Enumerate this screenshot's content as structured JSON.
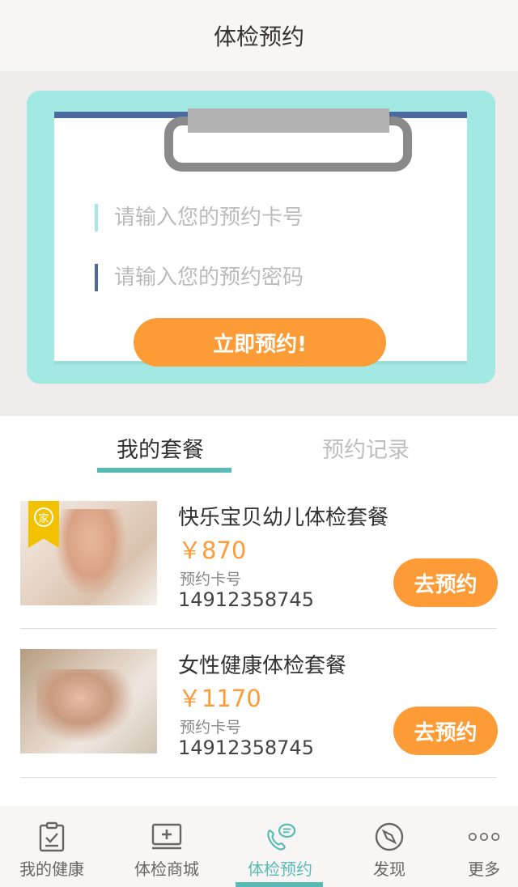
{
  "header": {
    "title": "体检预约"
  },
  "booking": {
    "card_placeholder": "请输入您的预约卡号",
    "password_placeholder": "请输入您的预约密码",
    "submit_label": "立即预约!"
  },
  "tabs": [
    {
      "label": "我的套餐",
      "active": true
    },
    {
      "label": "预约记录",
      "active": false
    }
  ],
  "packages": [
    {
      "badge": "家",
      "name": "快乐宝贝幼儿体检套餐",
      "price": "￥870",
      "card_label": "预约卡号",
      "card_number": "14912358745",
      "button_label": "去预约"
    },
    {
      "name": "女性健康体检套餐",
      "price": "￥1170",
      "card_label": "预约卡号",
      "card_number": "14912358745",
      "button_label": "去预约"
    }
  ],
  "bottom_nav": [
    {
      "label": "我的健康",
      "icon": "clipboard-check-icon",
      "active": false
    },
    {
      "label": "体检商城",
      "icon": "medical-monitor-icon",
      "active": false
    },
    {
      "label": "体检预约",
      "icon": "phone-chat-icon",
      "active": true
    },
    {
      "label": "发现",
      "icon": "compass-icon",
      "active": false
    },
    {
      "label": "更多",
      "icon": "more-dots-icon",
      "active": false
    }
  ],
  "colors": {
    "accent_orange": "#fd9b36",
    "accent_teal": "#58bcb4",
    "card_teal": "#a3e9e3",
    "card_navy": "#4c6a9d"
  }
}
